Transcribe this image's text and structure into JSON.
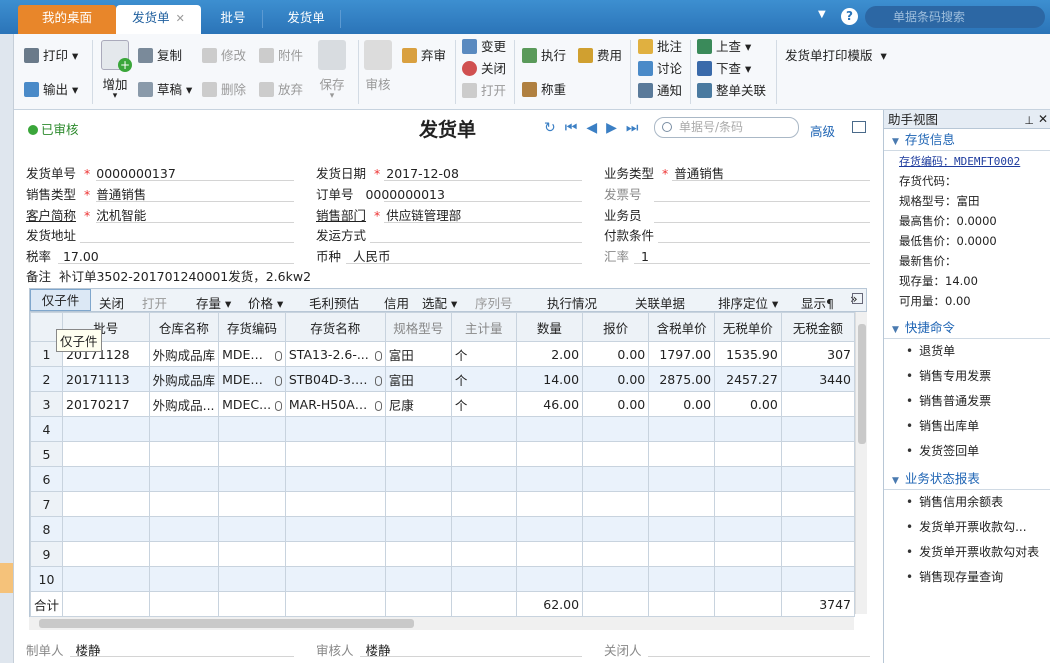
{
  "tabs": {
    "home": "我的桌面",
    "active": "发货单",
    "batch": "批号",
    "ship2": "发货单"
  },
  "search": {
    "placeholder": "单据条码搜索"
  },
  "toolbar": {
    "print": "打印",
    "export": "输出",
    "add": "增加",
    "copy": "复制",
    "draft": "草稿",
    "modify": "修改",
    "delete": "删除",
    "attach": "附件",
    "discard": "放弃",
    "save": "保存",
    "audit": "审核",
    "abandon_audit": "弃审",
    "change": "变更",
    "close": "关闭",
    "open": "打开",
    "execute": "执行",
    "fee": "费用",
    "weigh": "称重",
    "annotate": "批注",
    "discuss": "讨论",
    "notify": "通知",
    "up": "上查",
    "down": "下查",
    "linkall": "整单关联",
    "template": "发货单打印模版"
  },
  "header": {
    "status": "已审核",
    "title": "发货单",
    "advanced": "高级",
    "bill_search_placeholder": "单据号/条码"
  },
  "form": {
    "ship_no_label": "发货单号",
    "ship_no": "0000000137",
    "ship_date_label": "发货日期",
    "ship_date": "2017-12-08",
    "biz_type_label": "业务类型",
    "biz_type": "普通销售",
    "sale_type_label": "销售类型",
    "sale_type": "普通销售",
    "order_no_label": "订单号",
    "order_no": "0000000013",
    "invoice_no_label": "发票号",
    "invoice_no": "",
    "customer_label": "客户简称",
    "customer": "沈机智能",
    "dept_label": "销售部门",
    "dept": "供应链管理部",
    "salesman_label": "业务员",
    "salesman": "",
    "address_label": "发货地址",
    "address": "",
    "ship_method_label": "发运方式",
    "ship_method": "",
    "pay_terms_label": "付款条件",
    "pay_terms": "",
    "tax_label": "税率",
    "tax": "17.00",
    "currency_label": "币种",
    "currency": "人民币",
    "rate_label": "汇率",
    "rate": "1",
    "remark_label": "备注",
    "remark": "补订单3502-201701240001发货，2.6kw2"
  },
  "gridbar": {
    "onlychild": "仅子件",
    "close": "关闭",
    "open": "打开",
    "qty": "存量",
    "price": "价格",
    "margin": "毛利预估",
    "credit": "信用",
    "match": "选配",
    "serial": "序列号",
    "exec": "执行情况",
    "related": "关联单据",
    "sort": "排序定位",
    "display": "显示¶"
  },
  "table": {
    "headers": [
      "",
      "批号",
      "仓库名称",
      "存货编码",
      "存货名称",
      "规格型号",
      "主计量",
      "数量",
      "报价",
      "含税单价",
      "无税单价",
      "无税金额"
    ],
    "rows": [
      [
        "1",
        "20171128",
        "外购成品库",
        "MDEM...",
        "STA13-2.6-...",
        "富田",
        "个",
        "2.00",
        "0.00",
        "1797.00",
        "1535.90",
        "307"
      ],
      [
        "2",
        "20171113",
        "外购成品库",
        "MDEM...",
        "STB04D-3.6...",
        "富田",
        "个",
        "14.00",
        "0.00",
        "2875.00",
        "2457.27",
        "3440"
      ],
      [
        "3",
        "20170217",
        "外购成品...",
        "MDEC...",
        "MAR-H50AH...",
        "尼康",
        "个",
        "46.00",
        "0.00",
        "0.00",
        "0.00",
        ""
      ],
      [
        "4",
        "",
        "",
        "",
        "",
        "",
        "",
        "",
        "",
        "",
        "",
        ""
      ],
      [
        "5",
        "",
        "",
        "",
        "",
        "",
        "",
        "",
        "",
        "",
        "",
        ""
      ],
      [
        "6",
        "",
        "",
        "",
        "",
        "",
        "",
        "",
        "",
        "",
        "",
        ""
      ],
      [
        "7",
        "",
        "",
        "",
        "",
        "",
        "",
        "",
        "",
        "",
        "",
        ""
      ],
      [
        "8",
        "",
        "",
        "",
        "",
        "",
        "",
        "",
        "",
        "",
        "",
        ""
      ],
      [
        "9",
        "",
        "",
        "",
        "",
        "",
        "",
        "",
        "",
        "",
        "",
        ""
      ],
      [
        "10",
        "",
        "",
        "",
        "",
        "",
        "",
        "",
        "",
        "",
        "",
        ""
      ]
    ],
    "sum": [
      "合计",
      "",
      "",
      "",
      "",
      "",
      "",
      "62.00",
      "",
      "",
      "",
      "3747"
    ]
  },
  "tooltip": "仅子件",
  "footer": {
    "maker_label": "制单人",
    "maker": "楼静",
    "auditor_label": "审核人",
    "auditor": "楼静",
    "closer_label": "关闭人",
    "closer": ""
  },
  "assist": {
    "title": "助手视图",
    "sec1": "存货信息",
    "inv_code_label": "存货编码：MDEMFT0002",
    "inv_code2": "存货代码：",
    "spec": "规格型号：富田",
    "max_price": "最高售价：0.0000",
    "min_price": "最低售价：0.0000",
    "latest_price": "最新售价：",
    "stock": "现存量：14.00",
    "available": "可用量：0.00",
    "sec2": "快捷命令",
    "cmds": [
      "退货单",
      "销售专用发票",
      "销售普通发票",
      "销售出库单",
      "发货签回单"
    ],
    "sec3": "业务状态报表",
    "reports": [
      "销售信用余额表",
      "发货单开票收款勾...",
      "发货单开票收款勾对表",
      "销售现存量查询"
    ]
  }
}
